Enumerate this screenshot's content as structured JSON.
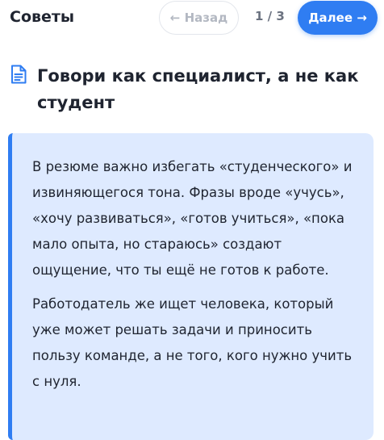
{
  "header": {
    "section_title": "Советы",
    "prev_label": "← Назад",
    "page_counter": "1 / 3",
    "next_label": "Далее →"
  },
  "tip": {
    "icon": "document-icon",
    "title": "Говори как специалист, а не как студент",
    "paragraphs": [
      "В резюме важно избегать «студенческого» и извиняющегося тона. Фразы вроде «учусь», «хочу развиваться», «готов учиться», «пока мало опыта, но стараюсь» создают ощущение, что ты ещё не готов к работе.",
      "Работодатель же ищет человека, который уже может решать задачи и приносить пользу команде, а не того, кого нужно учить с нуля."
    ]
  },
  "colors": {
    "accent": "#2f7df2",
    "callout_bg": "#deeaff"
  }
}
